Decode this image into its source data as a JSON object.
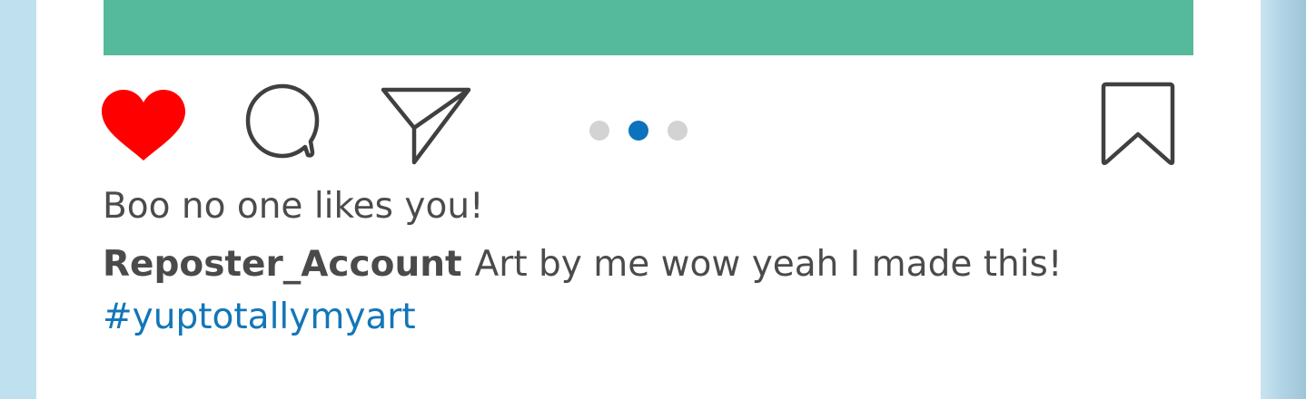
{
  "post": {
    "likes_text": "Boo no one likes you!",
    "username": "Reposter_Account",
    "caption": "Art by me wow yeah I made this!",
    "hashtag": "#yuptotallymyart"
  },
  "actions": {
    "like_icon": "heart-icon",
    "comment_icon": "speech-bubble-icon",
    "share_icon": "paper-plane-icon",
    "save_icon": "bookmark-icon",
    "liked": true
  },
  "carousel": {
    "total": 3,
    "active_index": 1
  },
  "colors": {
    "post_image": "#55b99b",
    "liked_heart": "#ff0000",
    "active_dot": "#0b72bd",
    "inactive_dot": "#d3d3d3",
    "hashtag": "#1276b8",
    "text": "#4b4b4b",
    "background": "#b9ddec"
  }
}
